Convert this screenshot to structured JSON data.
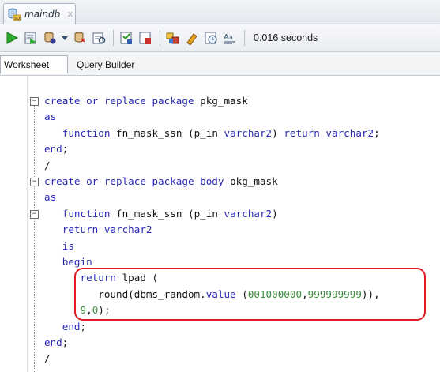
{
  "document_tab": {
    "title": "maindb",
    "icon": "database-sql-icon",
    "close_icon": "close-icon"
  },
  "toolbar": {
    "buttons": [
      "run-statement-icon",
      "run-script-icon",
      "commit-icon",
      "rollback-icon",
      "dropdown-arrow-icon",
      "autotrace-icon",
      "explain-plan-icon",
      "sql-tuning-icon",
      "unshared-sql-icon",
      "clear-icon",
      "history-icon",
      "format-text-icon"
    ],
    "execution_time": "0.016 seconds"
  },
  "subtabs": [
    {
      "label": "Worksheet",
      "active": true
    },
    {
      "label": "Query Builder",
      "active": false
    }
  ],
  "editor": {
    "lines": [
      [
        [
          "kw",
          "create or replace package "
        ],
        [
          "id",
          "pkg_mask"
        ]
      ],
      [
        [
          "kw",
          "as"
        ]
      ],
      [
        [
          "id",
          "   "
        ],
        [
          "kw",
          "function "
        ],
        [
          "id",
          "fn_mask_ssn (p_in "
        ],
        [
          "kw",
          "varchar2"
        ],
        [
          "id",
          ") "
        ],
        [
          "kw",
          "return varchar2"
        ],
        [
          "id",
          ";"
        ]
      ],
      [
        [
          "kw",
          "end"
        ],
        [
          "id",
          ";"
        ]
      ],
      [
        [
          "id",
          "/"
        ]
      ],
      [
        [
          "kw",
          "create or replace package body "
        ],
        [
          "id",
          "pkg_mask"
        ]
      ],
      [
        [
          "kw",
          "as"
        ]
      ],
      [
        [
          "id",
          "   "
        ],
        [
          "kw",
          "function "
        ],
        [
          "id",
          "fn_mask_ssn (p_in "
        ],
        [
          "kw",
          "varchar2"
        ],
        [
          "id",
          ")"
        ]
      ],
      [
        [
          "id",
          "   "
        ],
        [
          "kw",
          "return varchar2"
        ]
      ],
      [
        [
          "id",
          "   "
        ],
        [
          "kw",
          "is"
        ]
      ],
      [
        [
          "id",
          "   "
        ],
        [
          "kw",
          "begin"
        ]
      ],
      [
        [
          "id",
          "      "
        ],
        [
          "kw",
          "return "
        ],
        [
          "id",
          "lpad ("
        ]
      ],
      [
        [
          "id",
          "         round(dbms_random."
        ],
        [
          "kw",
          "value"
        ],
        [
          "id",
          " ("
        ],
        [
          "num",
          "001000000"
        ],
        [
          "id",
          ","
        ],
        [
          "num",
          "999999999"
        ],
        [
          "id",
          ")),"
        ]
      ],
      [
        [
          "id",
          "      "
        ],
        [
          "num",
          "9"
        ],
        [
          "id",
          ","
        ],
        [
          "num",
          "0"
        ],
        [
          "id",
          ");"
        ]
      ],
      [
        [
          "id",
          "   "
        ],
        [
          "kw",
          "end"
        ],
        [
          "id",
          ";"
        ]
      ],
      [
        [
          "kw",
          "end"
        ],
        [
          "id",
          ";"
        ]
      ],
      [
        [
          "id",
          "/"
        ]
      ]
    ]
  },
  "colors": {
    "keyword": "#2929b8",
    "number": "#3c8a3c",
    "highlight_border": "#e21b23"
  }
}
